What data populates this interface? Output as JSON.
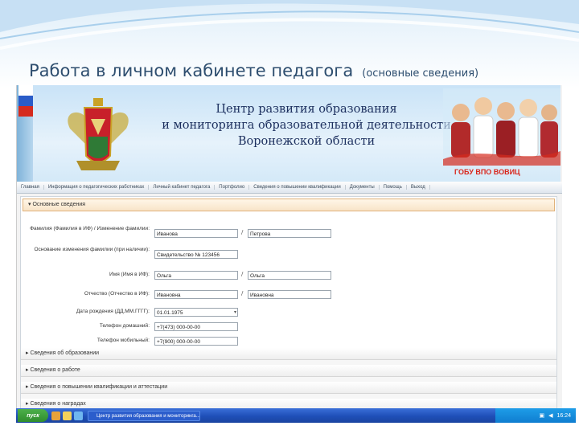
{
  "slide": {
    "title": "Работа в личном кабинете педагога",
    "subtitle": "(основные сведения)"
  },
  "banner": {
    "line1": "Центр развития образования",
    "line2": "и мониторинга образовательной деятельности",
    "line3": "Воронежской области",
    "badge": "ГОБУ ВПО ВОВИЦ"
  },
  "menu": {
    "items": [
      "Главная",
      "Информация о педагогических работниках",
      "Личный кабинет педагога",
      "Портфолио",
      "Сведения о повышении квалификации",
      "Документы",
      "Помощь",
      "Выход"
    ]
  },
  "sections": {
    "main": "▾ Основные сведения",
    "education": "▸ Сведения об образовании",
    "work": "▸ Сведения о работе",
    "qualification": "▸ Сведения о повышении квалификации и аттестации",
    "other": "▸ Сведения о наградах"
  },
  "form": {
    "row1": {
      "label": "Фамилия (Фамилия в ИФ) / Изменение фамилии:",
      "value": "Иванова",
      "value2": "Петрова"
    },
    "row2": {
      "label": "Основание изменения фамилии (при наличии):",
      "value": "Свидетельство № 123456"
    },
    "row3": {
      "label": "Имя (Имя в ИФ):",
      "value": "Ольга",
      "value2": "Ольга"
    },
    "row4": {
      "label": "Отчество (Отчество в ИФ):",
      "value": "Ивановна",
      "value2": "Ивановна"
    },
    "row5": {
      "label": "Дата рождения (ДД.ММ.ГГГГ):",
      "value": "01.01.1975"
    },
    "row6": {
      "label": "Телефон домашний:",
      "value": "+7(473) 000-00-00"
    },
    "row7": {
      "label": "Телефон мобильный:",
      "value": "+7(900) 000-00-00"
    }
  },
  "taskbar": {
    "start": "пуск",
    "task": "Центр развития образования и мониторинга...",
    "clock": "16:24"
  }
}
